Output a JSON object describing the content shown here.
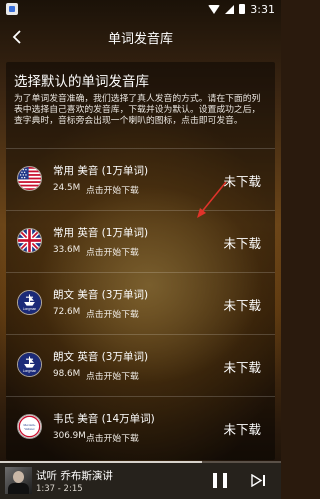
{
  "status_bar": {
    "time": "3:31"
  },
  "header": {
    "title": "单词发音库"
  },
  "panel": {
    "title": "选择默认的单词发音库",
    "description": "为了单词发音准确，我们选择了真人发音的方式。请在下面的列表中选择自己喜欢的发音库，下载并设为默认。设置成功之后，查字典时，音标旁会出现一个喇叭的图标，点击即可发音。"
  },
  "libraries": [
    {
      "name": "常用 美音 (1万单词)",
      "size": "24.5M",
      "hint": "点击开始下载",
      "status": "未下载",
      "icon": "us-flag-icon"
    },
    {
      "name": "常用 英音 (1万单词)",
      "size": "33.6M",
      "hint": "点击开始下载",
      "status": "未下载",
      "icon": "uk-flag-icon"
    },
    {
      "name": "朗文 美音 (3万单词)",
      "size": "72.6M",
      "hint": "点击开始下载",
      "status": "未下载",
      "icon": "longman-logo-icon"
    },
    {
      "name": "朗文 英音 (3万单词)",
      "size": "98.6M",
      "hint": "点击开始下载",
      "status": "未下载",
      "icon": "longman-logo-icon"
    },
    {
      "name": "韦氏 美音 (14万单词)",
      "size": "306.9M",
      "hint": "点击开始下载",
      "status": "未下载",
      "icon": "merriam-webster-logo-icon"
    }
  ],
  "logos": {
    "longman": "Longman",
    "merriam_webster": "Merriam-Webster"
  },
  "player": {
    "title": "试听 乔布斯演讲",
    "time": "1:37 - 2:15",
    "progress": 0.72
  },
  "colors": {
    "panel_bg": "rgba(0,0,0,0.42)",
    "arrow": "#e0332a",
    "player_bg": "#26221c"
  }
}
